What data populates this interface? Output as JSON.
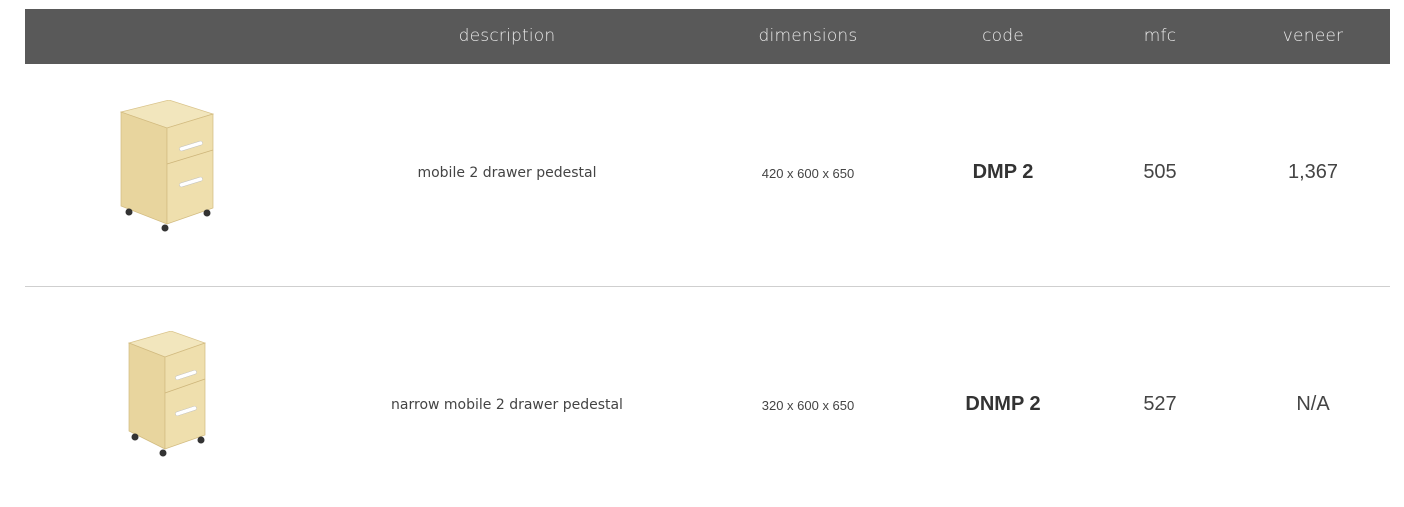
{
  "header": {
    "description": "description",
    "dimensions": "dimensions",
    "code": "code",
    "mfc": "mfc",
    "veneer": "veneer"
  },
  "rows": [
    {
      "image": "pedestal-2-drawer-icon",
      "description": "mobile 2 drawer pedestal",
      "dimensions": "420 x 600 x 650",
      "code": "DMP 2",
      "mfc": "505",
      "veneer": "1,367"
    },
    {
      "image": "narrow-pedestal-2-drawer-icon",
      "description": "narrow mobile 2 drawer pedestal",
      "dimensions": "320 x 600 x 650",
      "code": "DNMP 2",
      "mfc": "527",
      "veneer": "N/A"
    }
  ],
  "colors": {
    "header_bg": "#595959",
    "header_text": "#e9e9e9",
    "wood": "#ead9a6",
    "divider": "#cfcfcf"
  }
}
